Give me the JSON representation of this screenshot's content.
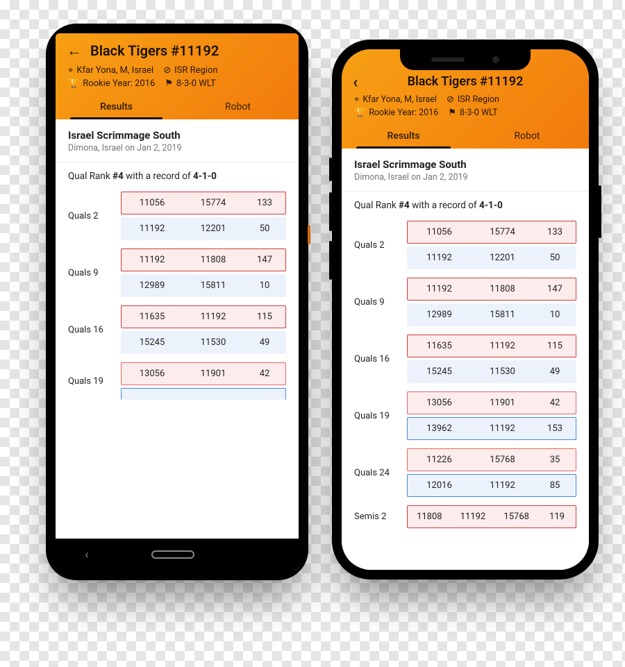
{
  "header": {
    "title": "Black Tigers #11192",
    "location": "Kfar Yona, M, Israel",
    "region": "ISR Region",
    "rookie": "Rookie Year: 2016",
    "record": "8-3-0 WLT",
    "tabs": {
      "results": "Results",
      "robot": "Robot"
    }
  },
  "event": {
    "name": "Israel Scrimmage South",
    "sub": "Dimona, Israel on Jan 2, 2019"
  },
  "rank": {
    "pre": "Qual Rank ",
    "rank": "#4",
    "mid": " with a record of ",
    "rec": "4-1-0"
  },
  "matches": {
    "q2": {
      "label": "Quals 2",
      "red": [
        "11056",
        "15774",
        "133"
      ],
      "blue": [
        "11192",
        "12201",
        "50"
      ],
      "winner": "red"
    },
    "q9": {
      "label": "Quals 9",
      "red": [
        "11192",
        "11808",
        "147"
      ],
      "blue": [
        "12989",
        "15811",
        "10"
      ],
      "winner": "red"
    },
    "q16": {
      "label": "Quals 16",
      "red": [
        "11635",
        "11192",
        "115"
      ],
      "blue": [
        "15245",
        "11530",
        "49"
      ],
      "winner": "red"
    },
    "q19": {
      "label": "Quals 19",
      "red": [
        "13056",
        "11901",
        "42"
      ],
      "blue": [
        "13962",
        "11192",
        "153"
      ],
      "winner": "blue"
    },
    "q24": {
      "label": "Quals 24",
      "red": [
        "11226",
        "15768",
        "35"
      ],
      "blue": [
        "12016",
        "11192",
        "85"
      ],
      "winner": "blue"
    },
    "s2": {
      "label": "Semis 2",
      "red": [
        "11808",
        "11192",
        "15768",
        "119"
      ],
      "winner": "red"
    }
  }
}
